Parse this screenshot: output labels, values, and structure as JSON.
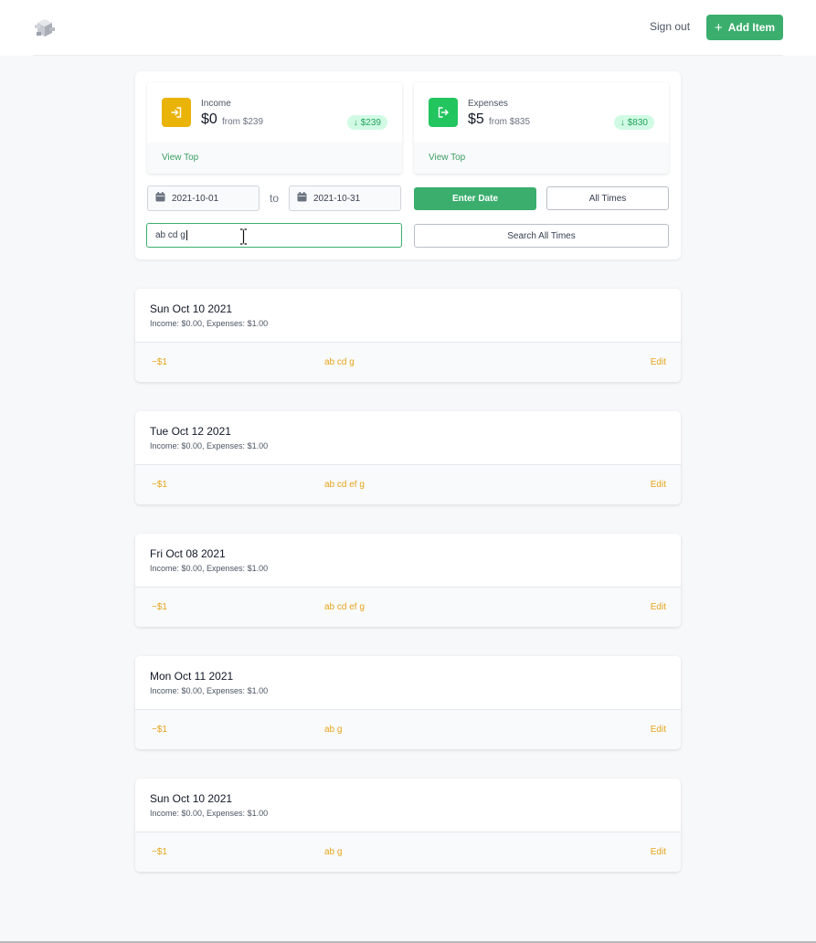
{
  "header": {
    "sign_out": "Sign out",
    "add_item": "Add Item"
  },
  "income": {
    "label": "Income",
    "amount": "$0",
    "from": "from $239",
    "badge": "$239",
    "view_top": "View Top",
    "color": "#eab308"
  },
  "expenses": {
    "label": "Expenses",
    "amount": "$5",
    "from": "from $835",
    "badge": "$830",
    "view_top": "View Top",
    "color": "#22c55e"
  },
  "filters": {
    "start_date": "2021-10-01",
    "to": "to",
    "end_date": "2021-10-31",
    "enter_date": "Enter Date",
    "all_times": "All Times",
    "search_value": "ab cd g",
    "search_all_times": "Search All Times"
  },
  "days": [
    {
      "date": "Sun Oct 10 2021",
      "summary": "Income: $0.00, Expenses: $1.00",
      "amount": "−$1",
      "description": "ab cd g",
      "edit": "Edit"
    },
    {
      "date": "Tue Oct 12 2021",
      "summary": "Income: $0.00, Expenses: $1.00",
      "amount": "−$1",
      "description": "ab cd ef g",
      "edit": "Edit"
    },
    {
      "date": "Fri Oct 08 2021",
      "summary": "Income: $0.00, Expenses: $1.00",
      "amount": "−$1",
      "description": "ab cd ef g",
      "edit": "Edit"
    },
    {
      "date": "Mon Oct 11 2021",
      "summary": "Income: $0.00, Expenses: $1.00",
      "amount": "−$1",
      "description": "ab g",
      "edit": "Edit"
    },
    {
      "date": "Sun Oct 10 2021",
      "summary": "Income: $0.00, Expenses: $1.00",
      "amount": "−$1",
      "description": "ab g",
      "edit": "Edit"
    }
  ],
  "colors": {
    "primary": "#3bae6e",
    "accent": "#e4a41a",
    "badge_bg": "#d1fae5"
  }
}
